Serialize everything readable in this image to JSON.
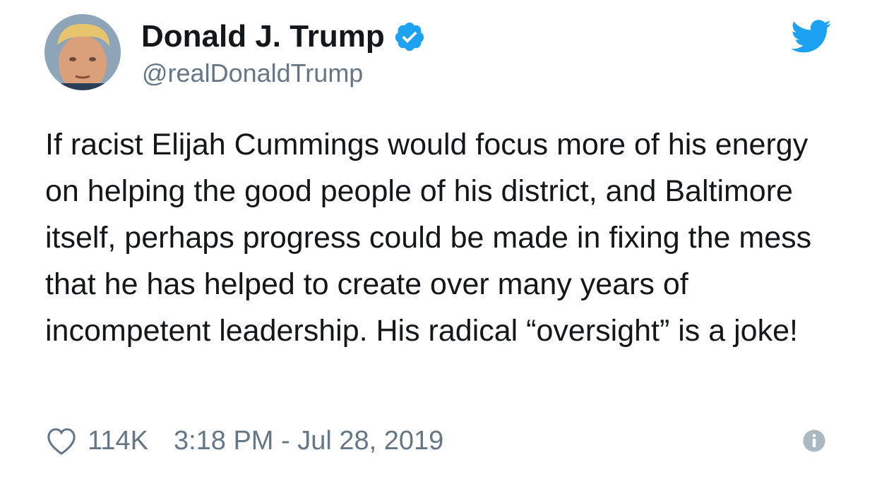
{
  "tweet": {
    "author": {
      "display_name": "Donald J. Trump",
      "handle": "@realDonaldTrump",
      "verified": true,
      "avatar_icon": "profile-photo"
    },
    "text": "If racist Elijah Cummings would focus more of his energy on helping the good people of his district, and Baltimore itself, perhaps progress could be made in fixing the mess that he has helped to create over many years of incompetent leadership. His radical “oversight” is a joke!",
    "likes": "114K",
    "timestamp": "3:18 PM - Jul 28, 2019"
  },
  "icons": {
    "verified": "verified-badge-icon",
    "brand": "twitter-bird-icon",
    "like": "heart-icon",
    "info": "info-icon"
  },
  "colors": {
    "brand_blue": "#1da1f2",
    "text_primary": "#14171a",
    "text_secondary": "#657786",
    "icon_gray": "#aab8c2"
  }
}
